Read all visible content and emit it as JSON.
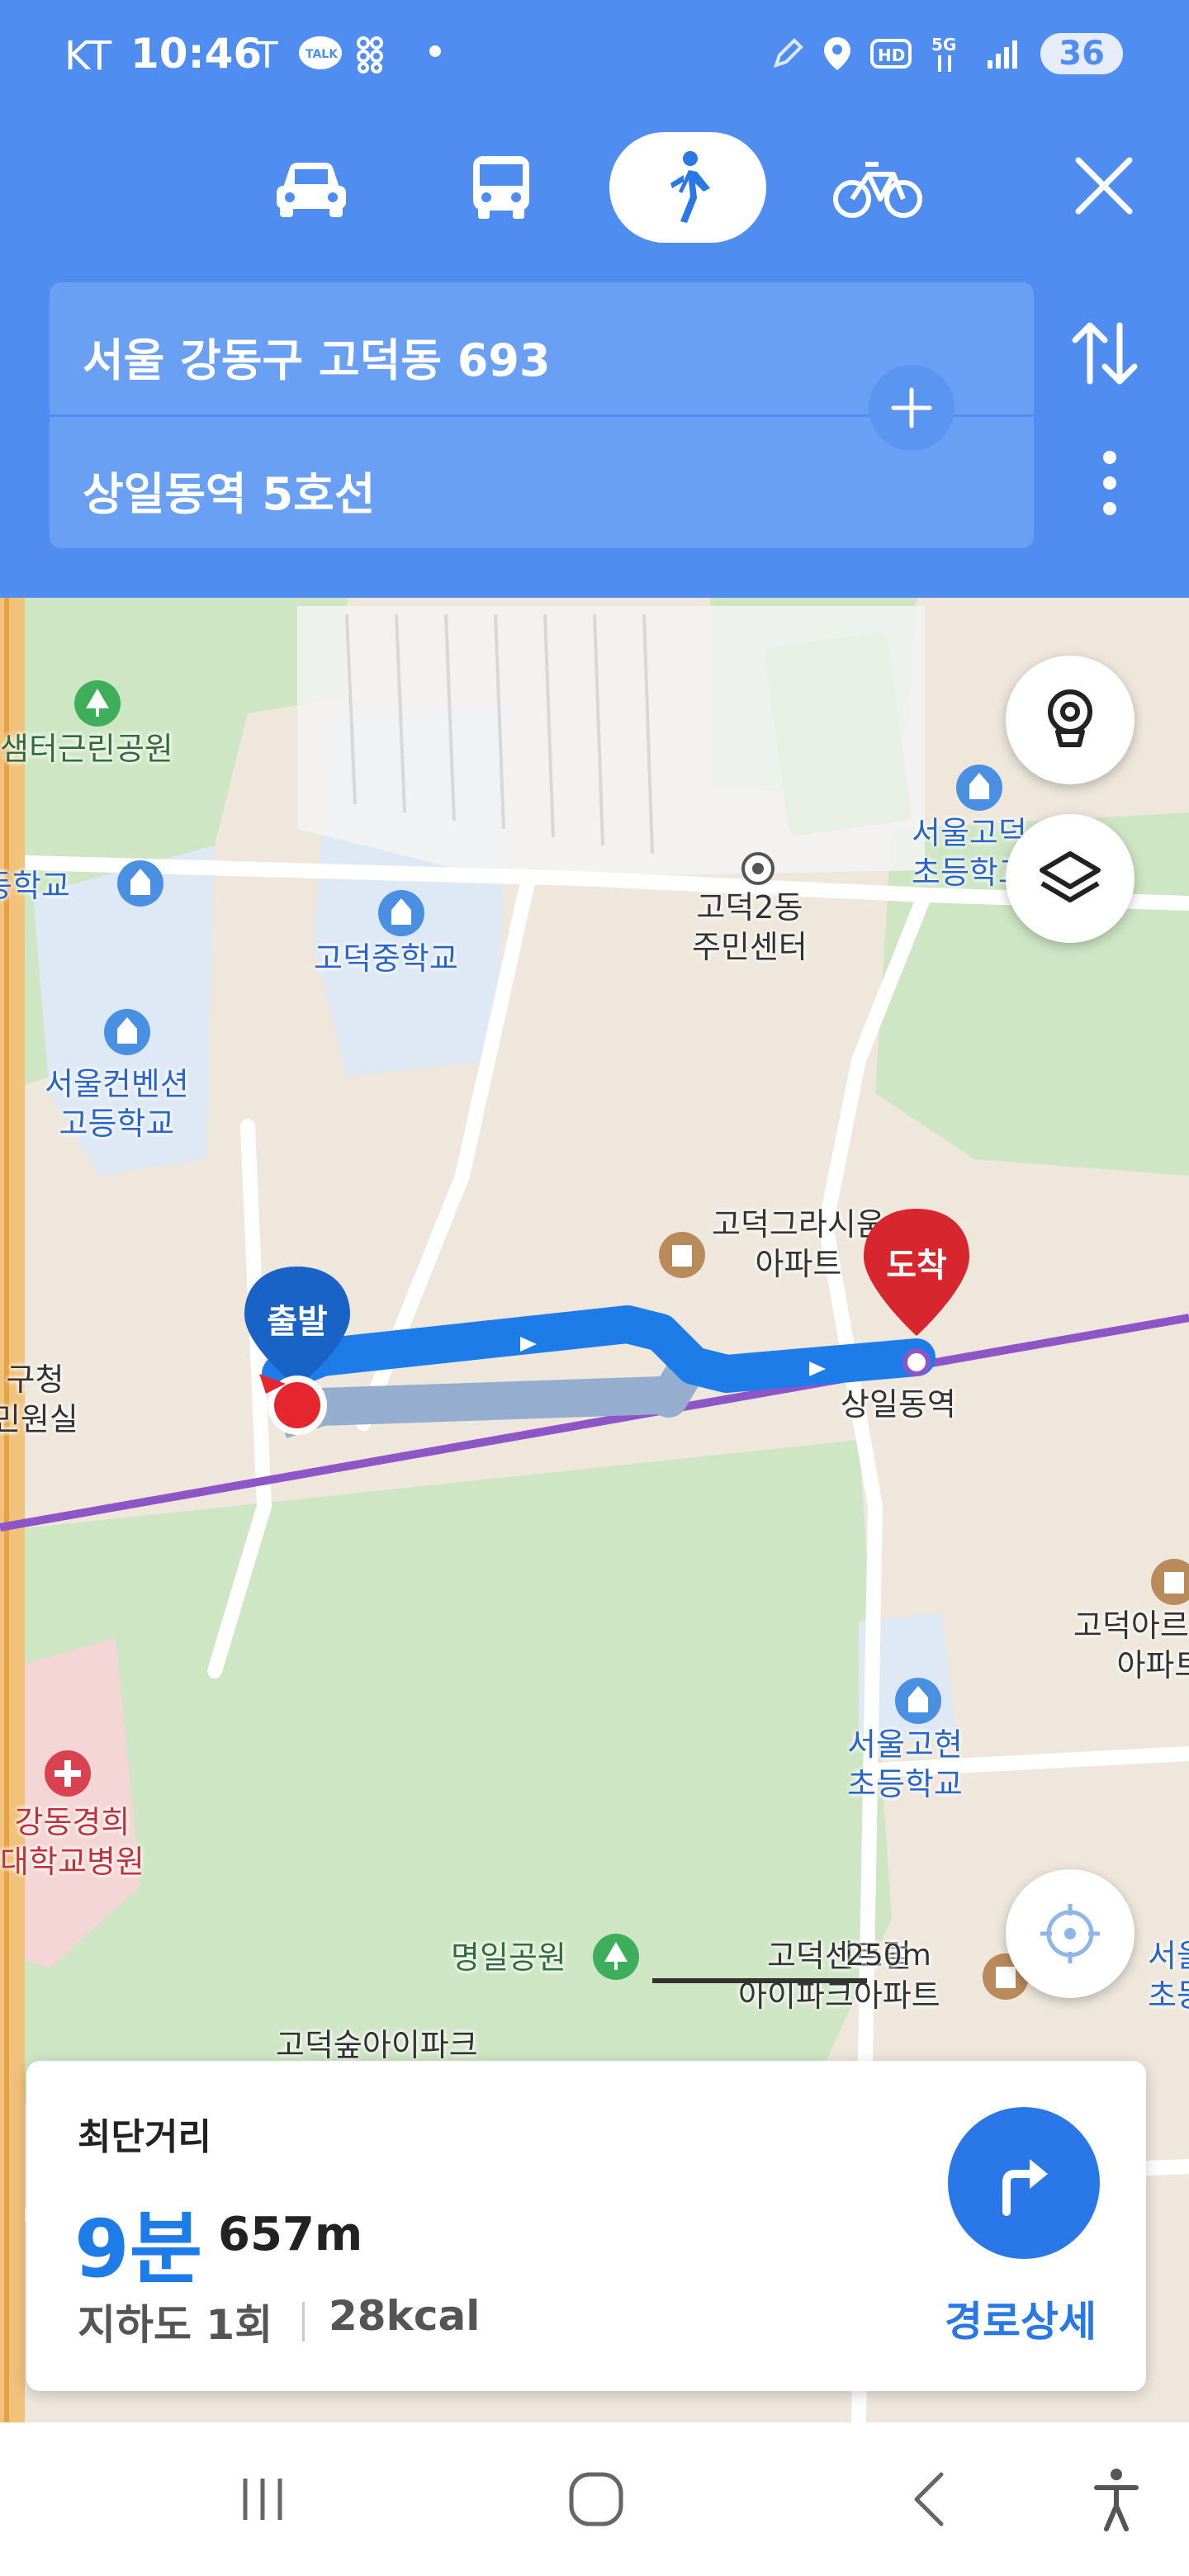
{
  "status_bar": {
    "carrier": "KT",
    "time": "10:46",
    "battery": "36",
    "left_icons": [
      "t-icon",
      "talk-icon",
      "grid-icon"
    ],
    "right_icons": [
      "pen-icon",
      "location-icon",
      "hd-icon",
      "5g-icon",
      "signal-icon"
    ]
  },
  "modes": {
    "items": [
      "car",
      "bus",
      "walk",
      "bike"
    ],
    "active": "walk"
  },
  "route": {
    "origin": "서울 강동구 고덕동 693",
    "destination": "상일동역 5호선"
  },
  "map": {
    "labels": {
      "park1": "샘터근린공원",
      "school1": "동학교",
      "school2": "고덕중학교",
      "community": "고덕2동\n주민센터",
      "school3": "서울고덕\n초등학교",
      "school4": "서울컨벤션\n고등학교",
      "apt1": "고덕그라시움\n아파트",
      "station": "상일동역",
      "office": "구청\n민원실",
      "apt2": "고덕아르테온\n아파트",
      "school5": "서울고현\n초등학교",
      "hospital": "강동경희\n대학교병원",
      "park2": "명일공원",
      "apt3": "고덕센트럴\n아이파크아파트",
      "apt4": "고덕숲아이파크",
      "school6": "서울\n초등"
    },
    "start_pin": "출발",
    "end_pin": "도착",
    "scale": "250m",
    "accent": "#1e7ce8",
    "line_color": "#8e55c6"
  },
  "summary": {
    "title": "최단거리",
    "time": "9분",
    "distance": "657m",
    "underpass": "지하도 1회",
    "kcal": "28kcal",
    "details_label": "경로상세"
  }
}
